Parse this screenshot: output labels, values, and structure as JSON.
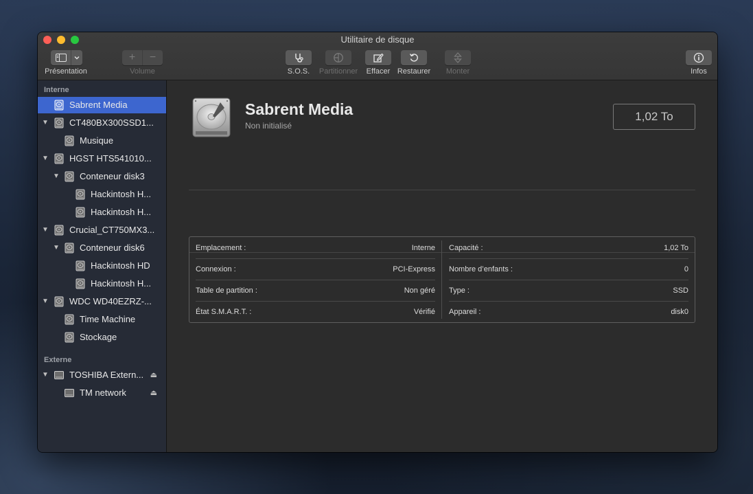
{
  "window": {
    "title": "Utilitaire de disque"
  },
  "toolbar": {
    "presentation": {
      "label": "Présentation"
    },
    "volume": {
      "label": "Volume",
      "add": "+",
      "remove": "−"
    },
    "sos": {
      "label": "S.O.S."
    },
    "partition": {
      "label": "Partitionner"
    },
    "erase": {
      "label": "Effacer"
    },
    "restore": {
      "label": "Restaurer"
    },
    "mount": {
      "label": "Monter"
    },
    "info": {
      "label": "Infos"
    }
  },
  "sidebar": {
    "sections": [
      {
        "title": "Interne"
      },
      {
        "title": "Externe"
      }
    ],
    "items": [
      {
        "label": "Sabrent Media",
        "selected": true,
        "icon": "internal-disk-icon"
      },
      {
        "label": "CT480BX300SSD1...",
        "icon": "internal-disk-icon"
      },
      {
        "label": "Musique",
        "icon": "volume-icon"
      },
      {
        "label": "HGST HTS541010...",
        "icon": "internal-disk-icon"
      },
      {
        "label": "Conteneur disk3",
        "icon": "container-icon"
      },
      {
        "label": "Hackintosh H...",
        "icon": "volume-icon"
      },
      {
        "label": "Hackintosh H...",
        "icon": "volume-icon"
      },
      {
        "label": "Crucial_CT750MX3...",
        "icon": "internal-disk-icon"
      },
      {
        "label": "Conteneur disk6",
        "icon": "container-icon"
      },
      {
        "label": "Hackintosh HD",
        "icon": "volume-icon"
      },
      {
        "label": "Hackintosh H...",
        "icon": "volume-icon"
      },
      {
        "label": "WDC WD40EZRZ-...",
        "icon": "internal-disk-icon"
      },
      {
        "label": "Time Machine",
        "icon": "volume-icon"
      },
      {
        "label": "Stockage",
        "icon": "volume-icon"
      },
      {
        "label": "TOSHIBA Extern...",
        "icon": "external-disk-icon",
        "eject": true
      },
      {
        "label": "TM network",
        "icon": "external-volume-icon",
        "eject": true
      }
    ]
  },
  "detail": {
    "name": "Sabrent Media",
    "subtitle": "Non initialisé",
    "capacity": "1,02 To",
    "left": [
      {
        "key": "Emplacement :",
        "value": "Interne"
      },
      {
        "key": "Connexion :",
        "value": "PCI-Express"
      },
      {
        "key": "Table de partition :",
        "value": "Non géré"
      },
      {
        "key": "État S.M.A.R.T. :",
        "value": "Vérifié"
      }
    ],
    "right": [
      {
        "key": "Capacité :",
        "value": "1,02 To"
      },
      {
        "key": "Nombre d’enfants :",
        "value": "0"
      },
      {
        "key": "Type :",
        "value": "SSD"
      },
      {
        "key": "Appareil :",
        "value": "disk0"
      }
    ]
  },
  "colors": {
    "selection": "#3d66cf",
    "sidebar_bg": "#262b36",
    "main_bg": "#2c2c2c"
  }
}
